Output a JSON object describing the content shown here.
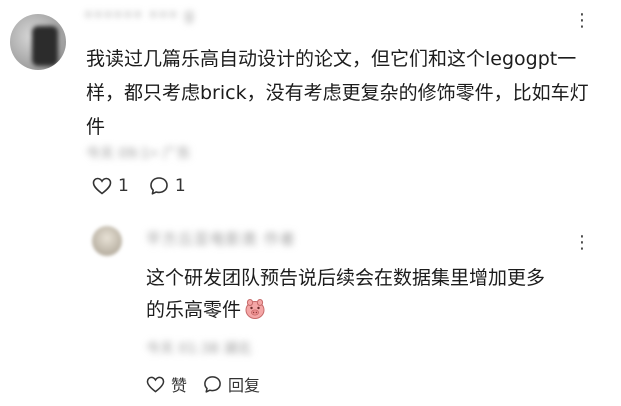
{
  "comment": {
    "username": "•••••• ••• g",
    "text": "我读过几篇乐高自动设计的论文，但它们和这个legogpt一样，都只考虑brick，没有考虑更复杂的修饰零件，比如车灯件",
    "meta": "今天 09:1• 广东",
    "like_count": "1",
    "reply_count": "1",
    "more": "⋮"
  },
  "reply": {
    "username": "平方丘亚电影类 作者",
    "text": "这个研发团队预告说后续会在数据集里增加更多的乐高零件",
    "emoji": "pig-face",
    "meta": "今天 01:38 湖北",
    "like_label": "赞",
    "reply_label": "回复",
    "more": "⋮"
  },
  "colors": {
    "text": "#1c1c1c",
    "muted": "#9a9a9a",
    "icon": "#333333"
  }
}
